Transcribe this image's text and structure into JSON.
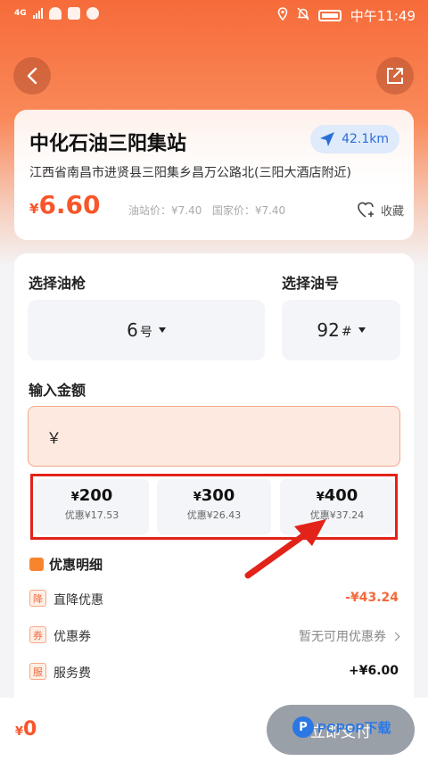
{
  "status_bar": {
    "network": "4G",
    "time": "中午11:49"
  },
  "nav": {
    "back_icon": "chevron-left-icon",
    "share_icon": "share-external-icon"
  },
  "station": {
    "name": "中化石油三阳集站",
    "distance": "42.1km",
    "address": "江西省南昌市进贤县三阳集乡昌万公路北(三阳大酒店附近)",
    "currency": "¥",
    "price": "6.60",
    "station_price": "油站价：¥7.40",
    "national_price": "国家价：¥7.40",
    "favorite_label": "收藏"
  },
  "form": {
    "nozzle_label": "选择油枪",
    "nozzle_value": "6",
    "nozzle_unit": "号",
    "fuel_label": "选择油号",
    "fuel_value": "92",
    "fuel_unit": "#",
    "amount_label": "输入金额",
    "amount_prefix": "￥",
    "amount_value": "",
    "presets": [
      {
        "currency": "¥",
        "amount": "200",
        "discount": "优惠¥17.53"
      },
      {
        "currency": "¥",
        "amount": "300",
        "discount": "优惠¥26.43"
      },
      {
        "currency": "¥",
        "amount": "400",
        "discount": "优惠¥37.24"
      }
    ]
  },
  "discount_detail": {
    "title": "优惠明细",
    "rows": [
      {
        "badge": "降",
        "label": "直降优惠",
        "value": "-¥43.24"
      },
      {
        "badge": "券",
        "label": "优惠券",
        "value": "暂无可用优惠券"
      },
      {
        "badge": "服",
        "label": "服务费",
        "value": "+¥6.00"
      }
    ]
  },
  "bottom": {
    "currency": "¥",
    "total": "0",
    "pay_label": "立即支付"
  },
  "watermark": {
    "logo_letter": "P",
    "text": "PCPOP下载"
  },
  "colors": {
    "accent": "#f7562a",
    "highlight": "#e2231a",
    "distance": "#2a6fd8"
  }
}
